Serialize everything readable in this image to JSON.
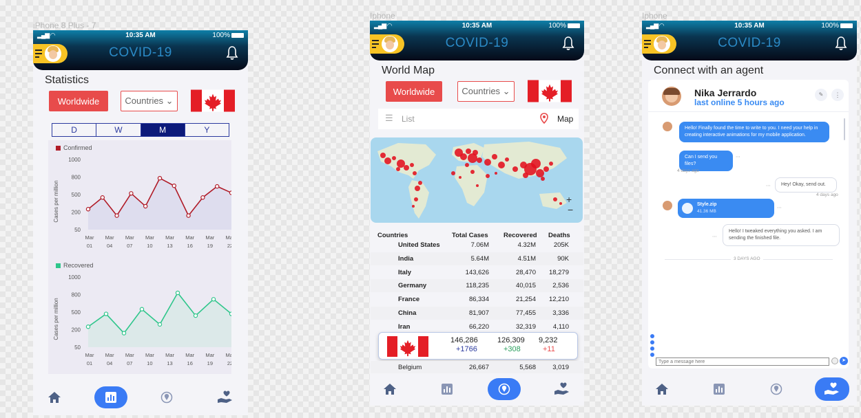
{
  "artboards": [
    "iPhone 8 Plus - 7",
    "Iphone",
    "Iphone"
  ],
  "status": {
    "time": "10:35 AM",
    "battery": "100%"
  },
  "app_title": "COVID-19",
  "phone1": {
    "title": "Statistics",
    "worldwide": "Worldwide",
    "countries": "Countries ⌄",
    "periods": [
      "D",
      "W",
      "M",
      "Y"
    ],
    "active_period": "M",
    "confirmed_legend": "Confirmed",
    "recovered_legend": "Recovered",
    "ylabel": "Cases per million"
  },
  "chart_data": [
    {
      "type": "line",
      "title": "Confirmed",
      "ylabel": "Cases per million",
      "categories": [
        "Mar 01",
        "Mar 04",
        "Mar 07",
        "Mar 10",
        "Mar 13",
        "Mar 16",
        "Mar 19",
        "Mar 22"
      ],
      "yticks": [
        1000,
        800,
        500,
        200,
        50
      ],
      "x": [
        0,
        0.5,
        1,
        1.5,
        2,
        2.5,
        3,
        3.5,
        4,
        4.5,
        5,
        5.5,
        6,
        6.5,
        7,
        7.5
      ],
      "values": [
        250,
        450,
        170,
        520,
        300,
        780,
        650,
        170,
        450,
        640,
        530
      ],
      "color": "#b01c28"
    },
    {
      "type": "line",
      "title": "Recovered",
      "ylabel": "Cases per million",
      "categories": [
        "Mar 01",
        "Mar 04",
        "Mar 07",
        "Mar 10",
        "Mar 13",
        "Mar 16",
        "Mar 19",
        "Mar 22"
      ],
      "yticks": [
        1000,
        800,
        500,
        200,
        50
      ],
      "values": [
        250,
        470,
        170,
        550,
        290,
        820,
        440,
        720,
        470
      ],
      "color": "#2fc68b"
    }
  ],
  "phone2": {
    "title": "World Map",
    "worldwide": "Worldwide",
    "countries": "Countries ⌄",
    "list_tab": "List",
    "map_tab": "Map",
    "table": {
      "headers": [
        "Countries",
        "Total Cases",
        "Recovered",
        "Deaths"
      ],
      "rows": [
        [
          "United States",
          "7.06M",
          "4.32M",
          "205K"
        ],
        [
          "India",
          "5.64M",
          "4.51M",
          "90K"
        ],
        [
          "Italy",
          "143,626",
          "28,470",
          "18,279"
        ],
        [
          "Germany",
          "118,235",
          "40,015",
          "2,536"
        ],
        [
          "France",
          "86,334",
          "21,254",
          "12,210"
        ],
        [
          "China",
          "81,907",
          "77,455",
          "3,336"
        ],
        [
          "Iran",
          "66,220",
          "32,319",
          "4,110"
        ]
      ],
      "last_row": [
        "Belgium",
        "26,667",
        "5,568",
        "3,019"
      ]
    },
    "highlight": {
      "cases": "146,286",
      "cases_delta": "+1766",
      "recovered": "126,309",
      "recovered_delta": "+308",
      "deaths": "9,232",
      "deaths_delta": "+11"
    }
  },
  "phone3": {
    "title": "Connect with an agent",
    "agent_name": "Nika Jerrardo",
    "agent_status": "last online 5 hours ago",
    "messages": {
      "m1": "Hello! Finally found the time to write to you. I need your help in creating interactive animations for my mobile application.",
      "m2": "Can I send you files?",
      "t1": "4 days ago",
      "m3": "Hey! Okay, send out.",
      "t2": "4 days ago",
      "file_name": "Style.zip",
      "file_size": "41.36 MB",
      "m4": "Hello! I tweaked everything you asked. I am sending the finished file.",
      "divider": "3 DAYS AGO"
    },
    "input_placeholder": "Type a message here"
  },
  "nav_icons": [
    "home-icon",
    "stats-icon",
    "map-pin-icon",
    "care-icon"
  ],
  "colors": {
    "accent_red": "#e84b4b",
    "nav_active": "#3a7bf5",
    "confirmed": "#b01c28",
    "recovered": "#2fc68b"
  }
}
